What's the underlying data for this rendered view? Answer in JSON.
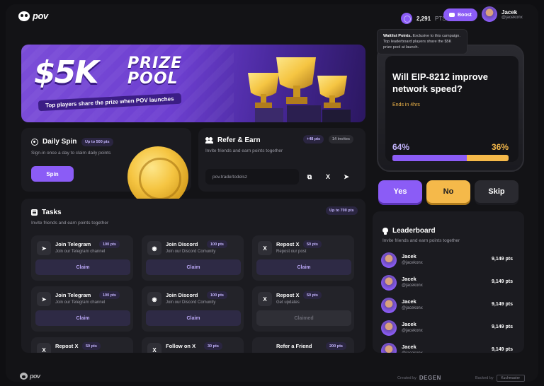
{
  "header": {
    "logo_text": "pov",
    "points_value": "2,291",
    "points_unit": "PTS",
    "boost_label": "Boost",
    "user_name": "Jacek",
    "user_handle": "@jacekonx"
  },
  "tooltip": {
    "title": "Waitlist Points.",
    "body": "Exclusive to this campaign. Top leaderboard players share the $5K prize pool at launch."
  },
  "banner": {
    "amount": "$5K",
    "word1": "PRIZE",
    "word2": "POOL",
    "subtitle": "Top players share the prize when POV launches"
  },
  "poll": {
    "question": "Will EIP-8212 improve network speed?",
    "ends": "Ends in 4hrs",
    "yes_pct": "64%",
    "no_pct": "36%",
    "yes_fraction": 0.64,
    "yes_label": "Yes",
    "no_label": "No",
    "skip_label": "Skip"
  },
  "daily_spin": {
    "title": "Daily Spin",
    "badge": "Up to 500 pts",
    "desc": "Sign-in once a day to claim daily points",
    "button": "Spin"
  },
  "refer": {
    "title": "Refer & Earn",
    "pts_badge": "+48 pts",
    "invites_badge": "14 invites",
    "desc": "Invite friends and earn points together",
    "link": "pov.trade/todelsz"
  },
  "tasks": {
    "title": "Tasks",
    "badge": "Up to 700 pts",
    "desc": "Invite friends and earn points together",
    "items": [
      {
        "icon": "telegram-icon",
        "glyph": "➤",
        "name": "Join Telegram",
        "pts": "100 pts",
        "desc": "Join our Telegram channel",
        "action": "Claim"
      },
      {
        "icon": "discord-icon",
        "glyph": "◉",
        "name": "Join Discord",
        "pts": "100 pts",
        "desc": "Join our Discord Comunity",
        "action": "Claim"
      },
      {
        "icon": "x-icon",
        "glyph": "X",
        "name": "Repost X",
        "pts": "50 pts",
        "desc": "Repost our post",
        "action": "Claim"
      },
      {
        "icon": "telegram-icon",
        "glyph": "➤",
        "name": "Join Telegram",
        "pts": "100 pts",
        "desc": "Join our Telegram channel",
        "action": "Claim"
      },
      {
        "icon": "discord-icon",
        "glyph": "◉",
        "name": "Join Discord",
        "pts": "100 pts",
        "desc": "Join our Discord Comunity",
        "action": "Claim"
      },
      {
        "icon": "x-icon",
        "glyph": "X",
        "name": "Repost X",
        "pts": "50 pts",
        "desc": "Get updates",
        "action": "Claimed"
      },
      {
        "icon": "x-icon",
        "glyph": "X",
        "name": "Repost X",
        "pts": "50 pts",
        "desc": "",
        "action": ""
      },
      {
        "icon": "x-icon",
        "glyph": "X",
        "name": "Follow on X",
        "pts": "30 pts",
        "desc": "",
        "action": ""
      },
      {
        "icon": "",
        "glyph": "",
        "name": "Refer a Friend",
        "pts": "200 pts",
        "desc": "",
        "action": ""
      }
    ]
  },
  "leaderboard": {
    "title": "Leaderboard",
    "desc": "Invite friends and earn points together",
    "rows": [
      {
        "name": "Jacek",
        "handle": "@jacekonx",
        "pts": "9,149 pts"
      },
      {
        "name": "Jacek",
        "handle": "@jacekonx",
        "pts": "9,149 pts"
      },
      {
        "name": "Jacek",
        "handle": "@jacekonx",
        "pts": "9,149 pts"
      },
      {
        "name": "Jacek",
        "handle": "@jacekonx",
        "pts": "9,149 pts"
      },
      {
        "name": "Jacek",
        "handle": "@jacekonx",
        "pts": "9,149 pts"
      }
    ]
  },
  "footer": {
    "logo_text": "pov",
    "created_by": "Created by",
    "created_brand": "DEGEN",
    "backed_by": "Backed by",
    "backed_brand": "Kuchmaster"
  },
  "colors": {
    "accent": "#8b5cf6",
    "yellow": "#f5b94a",
    "background": "#131316",
    "card": "#1b1b20"
  }
}
